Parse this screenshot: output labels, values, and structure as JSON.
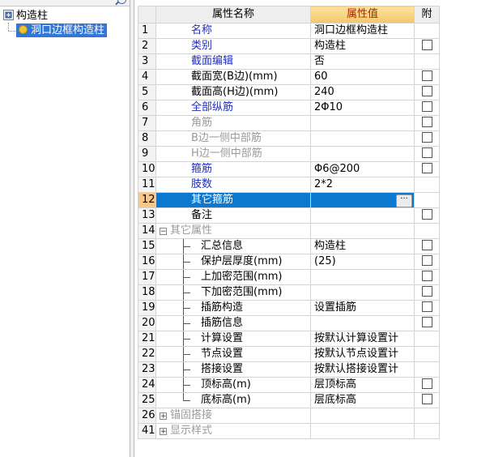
{
  "tree": {
    "root_label": "构造柱",
    "child_label": "洞口边框构造柱"
  },
  "grid": {
    "headers": {
      "num": "",
      "name": "属性名称",
      "value": "属性值",
      "attach": "附"
    },
    "rows": [
      {
        "num": "1",
        "name": "名称",
        "value": "洞口边框构造柱",
        "cb": false
      },
      {
        "num": "2",
        "name": "类别",
        "value": "构造柱",
        "cb": true
      },
      {
        "num": "3",
        "name": "截面编辑",
        "value": "否",
        "cb": false
      },
      {
        "num": "4",
        "name": "截面宽(B边)(mm)",
        "value": "60",
        "cb": true
      },
      {
        "num": "5",
        "name": "截面高(H边)(mm)",
        "value": "240",
        "cb": true
      },
      {
        "num": "6",
        "name": "全部纵筋",
        "value": "2Φ10",
        "cb": true
      },
      {
        "num": "7",
        "name": "角筋",
        "value": "",
        "cb": true
      },
      {
        "num": "8",
        "name": "B边一侧中部筋",
        "value": "",
        "cb": true
      },
      {
        "num": "9",
        "name": "H边一侧中部筋",
        "value": "",
        "cb": true
      },
      {
        "num": "10",
        "name": "箍筋",
        "value": "Φ6@200",
        "cb": true
      },
      {
        "num": "11",
        "name": "肢数",
        "value": "2*2",
        "cb": false
      },
      {
        "num": "12",
        "name": "其它箍筋",
        "value": "",
        "cb": false
      },
      {
        "num": "13",
        "name": "备注",
        "value": "",
        "cb": true
      },
      {
        "num": "14",
        "name": "其它属性",
        "value": "",
        "cb": false
      },
      {
        "num": "15",
        "name": "汇总信息",
        "value": "构造柱",
        "cb": true
      },
      {
        "num": "16",
        "name": "保护层厚度(mm)",
        "value": "(25)",
        "cb": true
      },
      {
        "num": "17",
        "name": "上加密范围(mm)",
        "value": "",
        "cb": true
      },
      {
        "num": "18",
        "name": "下加密范围(mm)",
        "value": "",
        "cb": true
      },
      {
        "num": "19",
        "name": "插筋构造",
        "value": "设置插筋",
        "cb": true
      },
      {
        "num": "20",
        "name": "插筋信息",
        "value": "",
        "cb": true
      },
      {
        "num": "21",
        "name": "计算设置",
        "value": "按默认计算设置计",
        "cb": false
      },
      {
        "num": "22",
        "name": "节点设置",
        "value": "按默认节点设置计",
        "cb": false
      },
      {
        "num": "23",
        "name": "搭接设置",
        "value": "按默认搭接设置计",
        "cb": false
      },
      {
        "num": "24",
        "name": "顶标高(m)",
        "value": "层顶标高",
        "cb": true
      },
      {
        "num": "25",
        "name": "底标高(m)",
        "value": "层底标高",
        "cb": true
      },
      {
        "num": "26",
        "name": "锚固搭接",
        "value": "",
        "cb": false
      },
      {
        "num": "41",
        "name": "显示样式",
        "value": "",
        "cb": false
      }
    ],
    "ellipsis_label": "···",
    "expand_collapse": "−",
    "expand_plus": "+"
  },
  "colors": {
    "selection": "#0c78d0",
    "blue_label": "#1f2fbf",
    "gray_label": "#9a9a9a",
    "header_value_bg": "#f6c766",
    "header_value_text": "#b22200"
  }
}
